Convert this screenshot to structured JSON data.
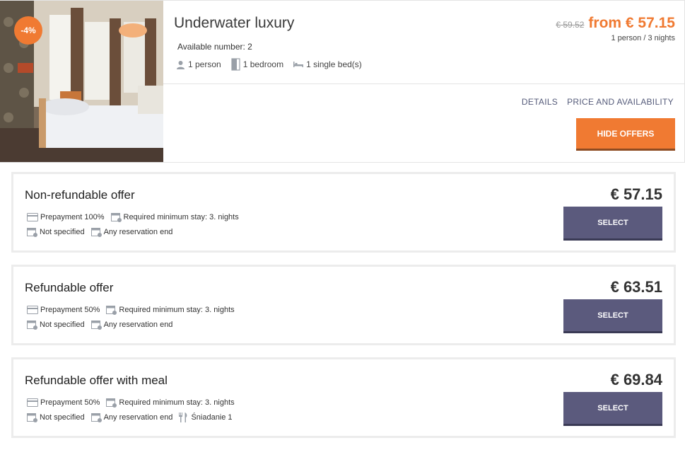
{
  "colors": {
    "accent": "#f07a32",
    "select": "#5b5a7d",
    "link": "#555b7a"
  },
  "room": {
    "discount_badge": "-4%",
    "title": "Underwater luxury",
    "available": "Available number: 2",
    "specs": {
      "persons": {
        "icon": "person-icon",
        "label": "1 person"
      },
      "bedrooms": {
        "icon": "door-icon",
        "label": "1 bedroom"
      },
      "beds": {
        "icon": "bed-icon",
        "label": "1 single bed(s)"
      }
    },
    "old_price": "€ 59.52",
    "from_price": "from € 57.15",
    "price_sub": "1 person / 3 nights",
    "links": {
      "details": "DETAILS",
      "price_availability": "PRICE AND AVAILABILITY"
    },
    "hide_offers_label": "HIDE OFFERS"
  },
  "offers": [
    {
      "title": "Non-refundable offer",
      "price": "€ 57.15",
      "prepayment": "Prepayment 100%",
      "min_stay": "Required minimum stay: 3. nights",
      "specified": "Not specified",
      "reservation_end": "Any reservation end",
      "select_label": "SELECT"
    },
    {
      "title": "Refundable offer",
      "price": "€ 63.51",
      "prepayment": "Prepayment 50%",
      "min_stay": "Required minimum stay: 3. nights",
      "specified": "Not specified",
      "reservation_end": "Any reservation end",
      "select_label": "SELECT"
    },
    {
      "title": "Refundable offer with meal",
      "price": "€ 69.84",
      "prepayment": "Prepayment 50%",
      "min_stay": "Required minimum stay: 3. nights",
      "specified": "Not specified",
      "reservation_end": "Any reservation end",
      "meal": "Śniadanie 1",
      "select_label": "SELECT"
    }
  ]
}
